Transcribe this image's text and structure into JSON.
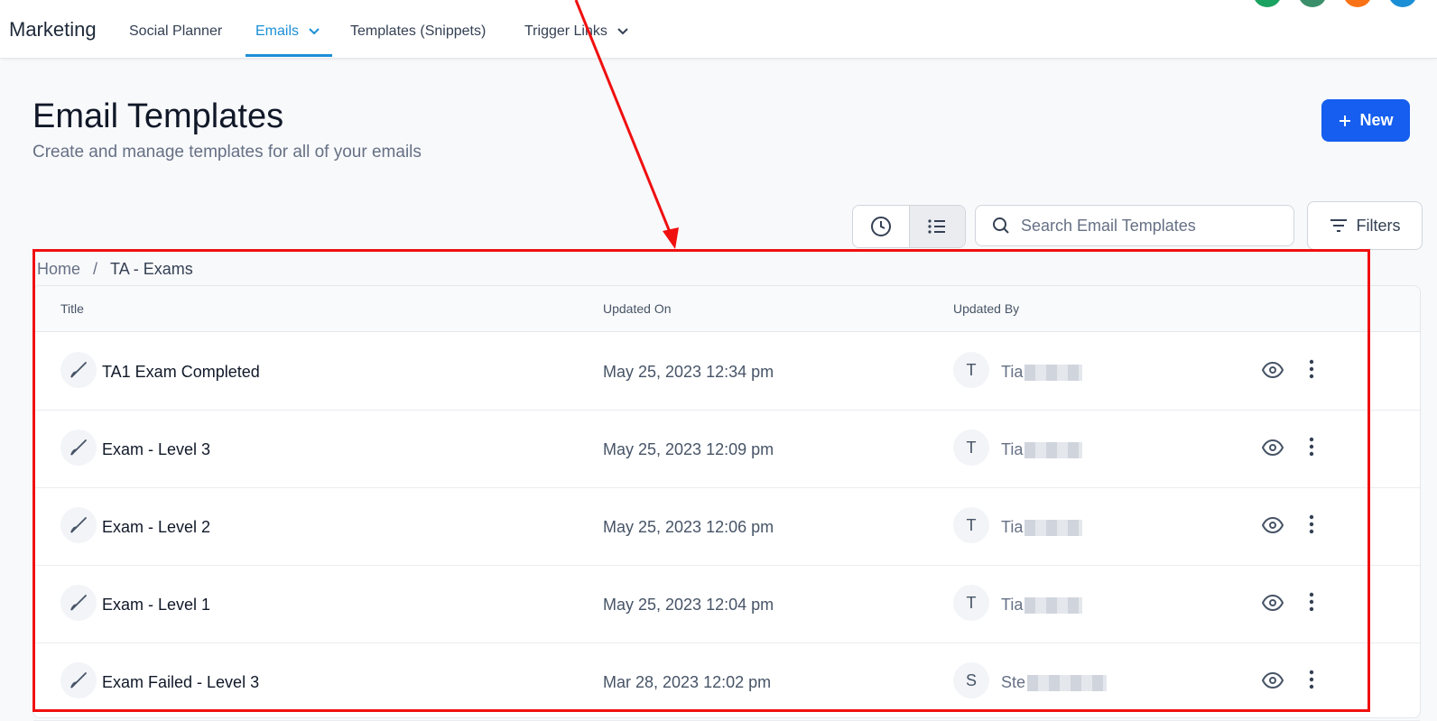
{
  "header": {
    "brand": "Marketing",
    "nav": [
      {
        "label": "Social Planner",
        "active": false,
        "dropdown": false
      },
      {
        "label": "Emails",
        "active": true,
        "dropdown": true
      },
      {
        "label": "Templates (Snippets)",
        "active": false,
        "dropdown": false
      },
      {
        "label": "Trigger Links",
        "active": false,
        "dropdown": true
      }
    ]
  },
  "page": {
    "title": "Email Templates",
    "subtitle": "Create and manage templates for all of your emails",
    "new_button": "New"
  },
  "toolbar": {
    "recent_view_icon": "clock-icon",
    "list_view_icon": "list-icon",
    "search_placeholder": "Search Email Templates",
    "filters_label": "Filters"
  },
  "breadcrumb": {
    "home": "Home",
    "separator": "/",
    "current": "TA - Exams"
  },
  "table": {
    "columns": [
      "Title",
      "Updated On",
      "Updated By"
    ],
    "rows": [
      {
        "title": "TA1 Exam Completed",
        "updated_on": "May 25, 2023 12:34 pm",
        "initial": "T",
        "user": "Tia"
      },
      {
        "title": "Exam - Level 3",
        "updated_on": "May 25, 2023 12:09 pm",
        "initial": "T",
        "user": "Tia"
      },
      {
        "title": "Exam - Level 2",
        "updated_on": "May 25, 2023 12:06 pm",
        "initial": "T",
        "user": "Tia"
      },
      {
        "title": "Exam - Level 1",
        "updated_on": "May 25, 2023 12:04 pm",
        "initial": "T",
        "user": "Tia"
      },
      {
        "title": "Exam Failed - Level 3",
        "updated_on": "Mar 28, 2023 12:02 pm",
        "initial": "S",
        "user": "Ste"
      }
    ]
  },
  "colors": {
    "accent": "#155eef",
    "active_nav": "#1b8fd6",
    "annotation": "#f01010"
  }
}
